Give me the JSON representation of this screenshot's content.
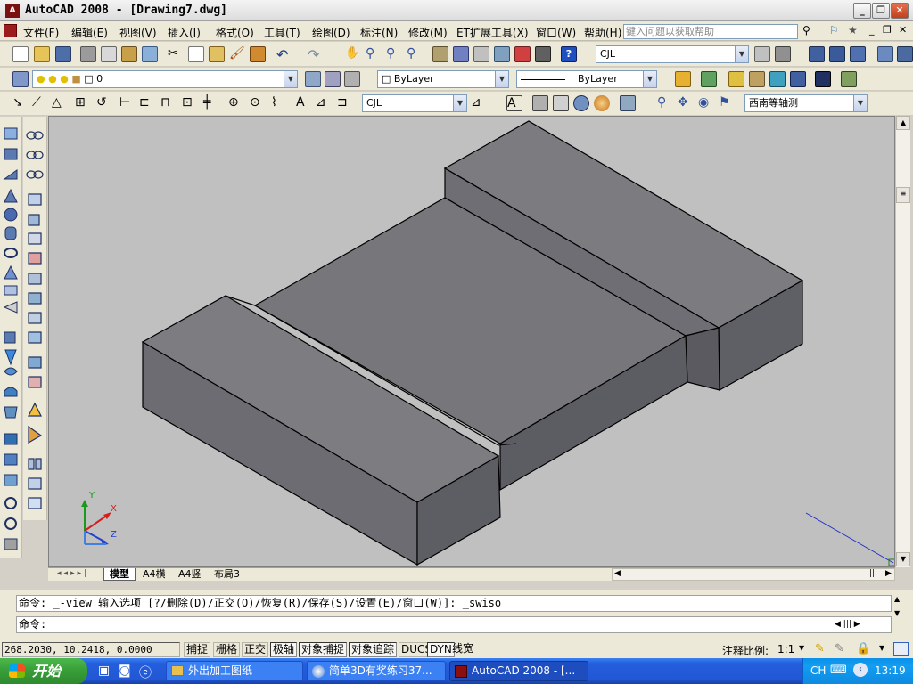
{
  "window": {
    "app_icon_text": "A",
    "title": "AutoCAD 2008 - [Drawing7.dwg]",
    "controls": [
      "_",
      "❐",
      "✕"
    ]
  },
  "menubar": {
    "items": [
      "文件(F)",
      "编辑(E)",
      "视图(V)",
      "插入(I)",
      "格式(O)",
      "工具(T)",
      "绘图(D)",
      "标注(N)",
      "修改(M)",
      "ET扩展工具(X)",
      "窗口(W)",
      "帮助(H)"
    ],
    "help_placeholder": "键入问题以获取帮助",
    "doc_controls": [
      "_",
      "❐",
      "✕"
    ]
  },
  "toolbar1": {
    "textstyle_combo": "CJL"
  },
  "toolbar2": {
    "layer_combo": "0",
    "color_combo": "ByLayer",
    "linetype_combo": "ByLayer"
  },
  "toolbar3": {
    "dimstyle_combo": "CJL",
    "view_combo": "西南等轴测"
  },
  "tabs": [
    "模型",
    "A4横",
    "A4竖",
    "布局3"
  ],
  "command": {
    "history": "命令: _-view 输入选项 [?/删除(D)/正交(O)/恢复(R)/保存(S)/设置(E)/窗口(W)]: _swiso",
    "prompt": "命令:"
  },
  "statusbar": {
    "coords": "268.2030, 10.2418, 0.0000",
    "toggles": [
      "捕捉",
      "栅格",
      "正交",
      "极轴",
      "对象捕捉",
      "对象追踪",
      "DUCS",
      "DYN",
      "线宽"
    ],
    "annotation_scale_label": "注释比例:",
    "annotation_scale_value": "1:1"
  },
  "taskbar": {
    "start_label": "开始",
    "tasks": [
      "外出加工图纸",
      "简单3D有奖练习37...",
      "AutoCAD 2008 - [..."
    ],
    "lang": "CH",
    "clock": "13:19"
  },
  "ucs": {
    "x": "X",
    "y": "Y",
    "z": "Z"
  },
  "colors": {
    "face_top": "#7c7c80",
    "face_front": "#6d6d72",
    "face_side": "#5e5e64",
    "viewport_bg": "#c0c0c0"
  }
}
